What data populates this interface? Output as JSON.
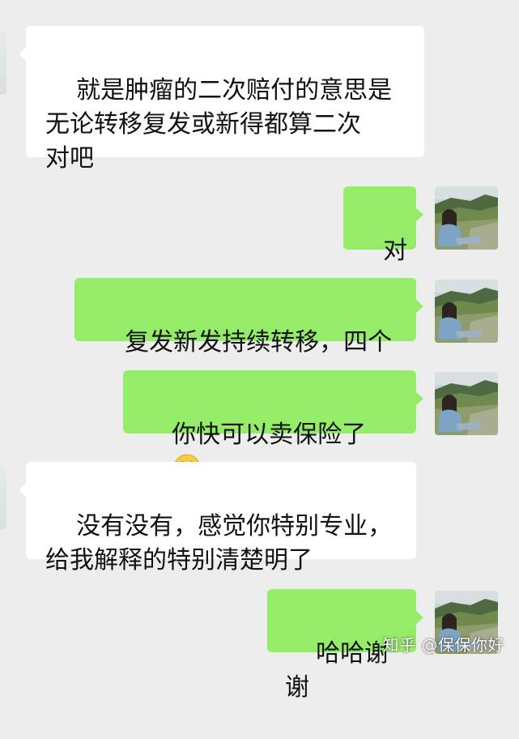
{
  "colors": {
    "background": "#ededed",
    "sent_bubble": "#95ec69",
    "received_bubble": "#ffffff",
    "text": "#111111"
  },
  "messages": [
    {
      "side": "left",
      "text": "就是肿瘤的二次赔付的意思是\n无论转移复发或新得都算二次\n对吧"
    },
    {
      "side": "right",
      "text": "对"
    },
    {
      "side": "right",
      "text": "复发新发持续转移，四个"
    },
    {
      "side": "right",
      "text": "你快可以卖保险了",
      "emoji": "grinning-face-emoji"
    },
    {
      "side": "left",
      "text": "没有没有，感觉你特别专业，\n给我解释的特别清楚明了"
    },
    {
      "side": "right",
      "text": "哈哈谢谢"
    }
  ],
  "watermark": "知乎 @保保你好",
  "avatar_icon": "landscape-person-avatar"
}
